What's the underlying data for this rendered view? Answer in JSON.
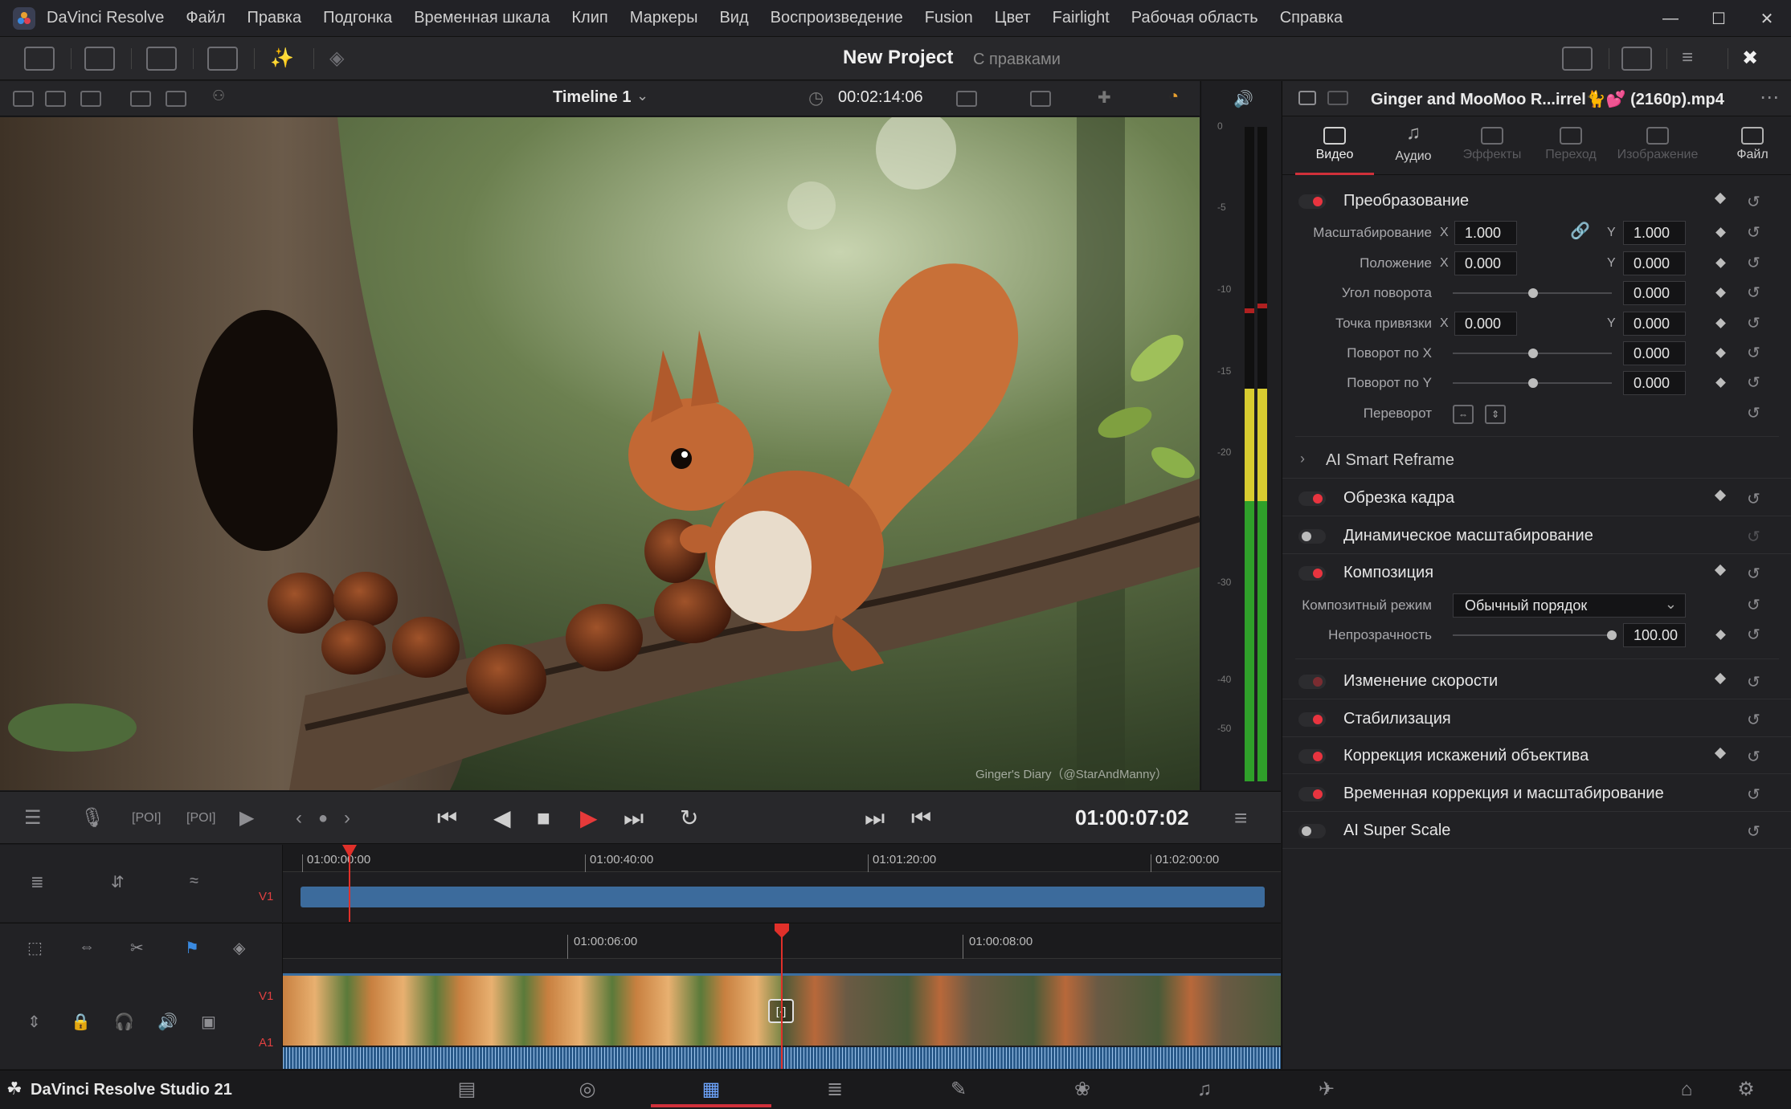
{
  "app": {
    "title": "DaVinci Resolve",
    "menu": [
      "Файл",
      "Правка",
      "Подгонка",
      "Временная шкала",
      "Клип",
      "Маркеры",
      "Вид",
      "Воспроизведение",
      "Fusion",
      "Цвет",
      "Fairlight",
      "Рабочая область",
      "Справка"
    ]
  },
  "project": {
    "title": "New Project",
    "status": "С правками"
  },
  "viewer": {
    "timeline_name": "Timeline 1",
    "timeline_duration": "00:02:14:06",
    "watermark": "Ginger's Diary（@StarAndManny）",
    "current_timecode": "01:00:07:02"
  },
  "meter": {
    "scale": [
      "0",
      "-5",
      "-10",
      "-15",
      "-20",
      "-30",
      "-40",
      "-50"
    ]
  },
  "timeline": {
    "upper_ruler": [
      "01:00:00:00",
      "01:00:40:00",
      "01:01:20:00",
      "01:02:00:00"
    ],
    "lower_ruler": [
      "01:00:06:00",
      "01:00:08:00"
    ],
    "tracks": {
      "v1": "V1",
      "a1": "A1"
    }
  },
  "inspector": {
    "clip_name": "Ginger and MooMoo R...irrel🐈💕 (2160p).mp4",
    "tabs": [
      "Видео",
      "Аудио",
      "Эффекты",
      "Переход",
      "Изображение",
      "Файл"
    ],
    "transform": {
      "title": "Преобразование",
      "zoom_label": "Масштабирование",
      "zoom_x": "1.000",
      "zoom_y": "1.000",
      "position_label": "Положение",
      "position_x": "0.000",
      "position_y": "0.000",
      "rotation_label": "Угол поворота",
      "rotation": "0.000",
      "anchor_label": "Точка привязки",
      "anchor_x": "0.000",
      "anchor_y": "0.000",
      "pitch_label": "Поворот по X",
      "pitch": "0.000",
      "yaw_label": "Поворот по Y",
      "yaw": "0.000",
      "flip_label": "Переворот",
      "axis_x": "X",
      "axis_y": "Y"
    },
    "smart_reframe": "AI Smart Reframe",
    "cropping": "Обрезка кадра",
    "dynamic_zoom": "Динамическое масштабирование",
    "composite": {
      "title": "Композиция",
      "mode_label": "Композитный режим",
      "mode_value": "Обычный порядок",
      "opacity_label": "Непрозрачность",
      "opacity": "100.00"
    },
    "speed_change": "Изменение скорости",
    "stabilization": "Стабилизация",
    "lens_correction": "Коррекция искажений объектива",
    "retime_scaling": "Временная коррекция и масштабирование",
    "super_scale": "AI Super Scale"
  },
  "footer": {
    "brand": "DaVinci Resolve Studio 21"
  }
}
